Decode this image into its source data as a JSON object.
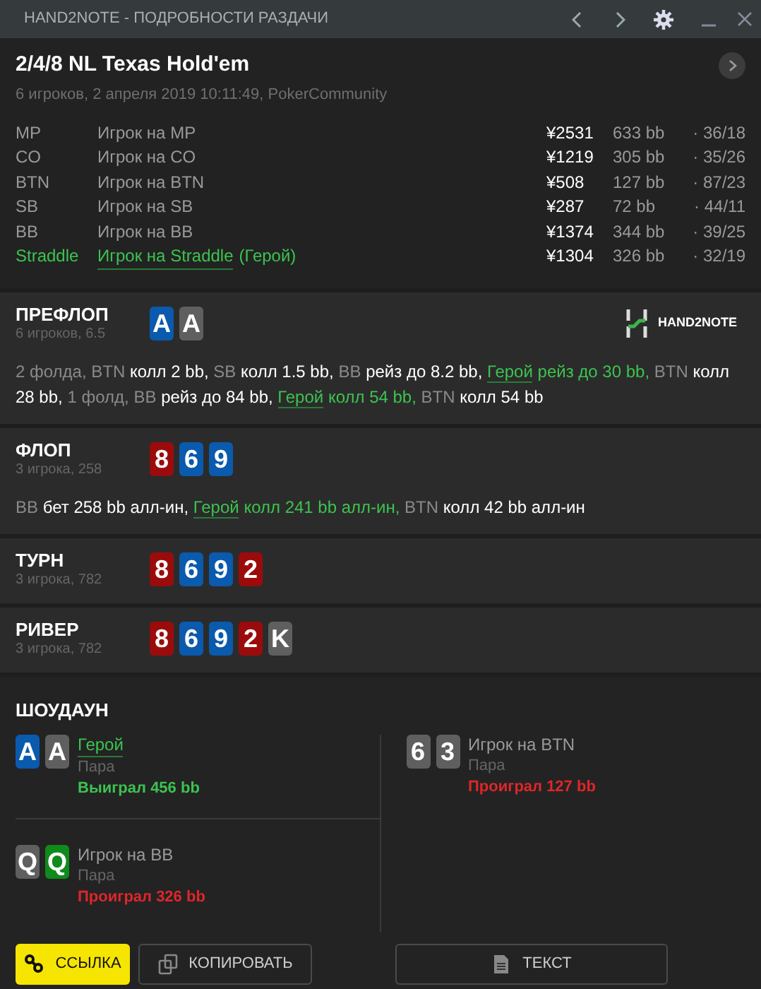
{
  "window": {
    "title": "HAND2NOTE - ПОДРОБНОСТИ РАЗДАЧИ"
  },
  "hand": {
    "title": "2/4/8 NL Texas Hold'em",
    "subtitle": "6 игроков, 2 апреля 2019 10:11:49, PokerCommunity"
  },
  "players": [
    {
      "position": "MP",
      "name": "Игрок на MP",
      "hero": false,
      "stack": "¥2531",
      "bb": "633 bb",
      "stats": "· 36/18"
    },
    {
      "position": "CO",
      "name": "Игрок на CO",
      "hero": false,
      "stack": "¥1219",
      "bb": "305 bb",
      "stats": "· 35/26"
    },
    {
      "position": "BTN",
      "name": "Игрок на BTN",
      "hero": false,
      "stack": "¥508",
      "bb": "127 bb",
      "stats": "· 87/23"
    },
    {
      "position": "SB",
      "name": "Игрок на SB",
      "hero": false,
      "stack": "¥287",
      "bb": "72 bb",
      "stats": "· 44/11"
    },
    {
      "position": "BB",
      "name": "Игрок на BB",
      "hero": false,
      "stack": "¥1374",
      "bb": "344 bb",
      "stats": "· 39/25"
    },
    {
      "position": "Straddle",
      "name": "Игрок на Straddle",
      "hero": true,
      "hero_tag": "(Герой)",
      "stack": "¥1304",
      "bb": "326 bb",
      "stats": "· 32/19"
    }
  ],
  "streets": [
    {
      "name": "ПРЕФЛОП",
      "info": "6 игроков, 6.5",
      "logo": "HAND2NOTE",
      "cards": [
        {
          "rank": "A",
          "color": "#0a5aad"
        },
        {
          "rank": "A",
          "color": "#5f5f5f"
        }
      ],
      "actions": [
        {
          "kind": "dim",
          "text": "2 фолда,"
        },
        {
          "kind": "dim",
          "text": "BTN"
        },
        {
          "kind": "act",
          "text": "колл 2 bb,"
        },
        {
          "kind": "dim",
          "text": "SB"
        },
        {
          "kind": "act",
          "text": "колл 1.5 bb,"
        },
        {
          "kind": "dim",
          "text": "BB"
        },
        {
          "kind": "act",
          "text": "рейз до 8.2 bb,"
        },
        {
          "kind": "hero",
          "text": "Герой"
        },
        {
          "kind": "hero_act",
          "text": "рейз до 30 bb,"
        },
        {
          "kind": "dim",
          "text": "BTN"
        },
        {
          "kind": "act",
          "text": "колл 28 bb,"
        },
        {
          "kind": "dim",
          "text": "1 фолд,"
        },
        {
          "kind": "dim",
          "text": "BB"
        },
        {
          "kind": "act",
          "text": "рейз до 84 bb,"
        },
        {
          "kind": "hero",
          "text": "Герой"
        },
        {
          "kind": "hero_act",
          "text": "колл 54 bb,"
        },
        {
          "kind": "dim",
          "text": "BTN"
        },
        {
          "kind": "act",
          "text": "колл 54 bb"
        }
      ]
    },
    {
      "name": "ФЛОП",
      "info": "3 игрока, 258",
      "cards": [
        {
          "rank": "8",
          "color": "#9c0b0b"
        },
        {
          "rank": "6",
          "color": "#0a5aad"
        },
        {
          "rank": "9",
          "color": "#0a5aad"
        }
      ],
      "actions": [
        {
          "kind": "dim",
          "text": "BB"
        },
        {
          "kind": "act",
          "text": "бет 258 bb алл-ин,"
        },
        {
          "kind": "hero",
          "text": "Герой"
        },
        {
          "kind": "hero_act",
          "text": "колл 241 bb алл-ин,"
        },
        {
          "kind": "dim",
          "text": "BTN"
        },
        {
          "kind": "act",
          "text": "колл 42 bb алл-ин"
        }
      ]
    },
    {
      "name": "ТУРН",
      "info": "3 игрока, 782",
      "cards": [
        {
          "rank": "8",
          "color": "#9c0b0b"
        },
        {
          "rank": "6",
          "color": "#0a5aad"
        },
        {
          "rank": "9",
          "color": "#0a5aad"
        },
        {
          "rank": "2",
          "color": "#9c0b0b"
        }
      ]
    },
    {
      "name": "РИВЕР",
      "info": "3 игрока, 782",
      "cards": [
        {
          "rank": "8",
          "color": "#9c0b0b"
        },
        {
          "rank": "6",
          "color": "#0a5aad"
        },
        {
          "rank": "9",
          "color": "#0a5aad"
        },
        {
          "rank": "2",
          "color": "#9c0b0b"
        },
        {
          "rank": "K",
          "color": "#5f5f5f"
        }
      ]
    }
  ],
  "showdown": {
    "title": "ШОУДАУН",
    "hands": [
      {
        "name": "Герой",
        "hero": true,
        "combo": "Пара",
        "result": "Выиграл 456 bb",
        "won": true,
        "cards": [
          {
            "rank": "A",
            "color": "#0a5aad"
          },
          {
            "rank": "A",
            "color": "#5f5f5f"
          }
        ]
      },
      {
        "name": "Игрок на BTN",
        "hero": false,
        "combo": "Пара",
        "result": "Проиграл 127 bb",
        "won": false,
        "cards": [
          {
            "rank": "6",
            "color": "#5f5f5f"
          },
          {
            "rank": "3",
            "color": "#5f5f5f"
          }
        ]
      },
      {
        "name": "Игрок на BB",
        "hero": false,
        "combo": "Пара",
        "result": "Проиграл 326 bb",
        "won": false,
        "cards": [
          {
            "rank": "Q",
            "color": "#5f5f5f"
          },
          {
            "rank": "Q",
            "color": "#0f8a1c"
          }
        ]
      }
    ]
  },
  "buttons": [
    {
      "kind": "link",
      "label": "ССЫЛКА"
    },
    {
      "kind": "copy",
      "label": "КОПИРОВАТЬ"
    },
    {
      "kind": "text",
      "label": "ТЕКСТ"
    }
  ]
}
